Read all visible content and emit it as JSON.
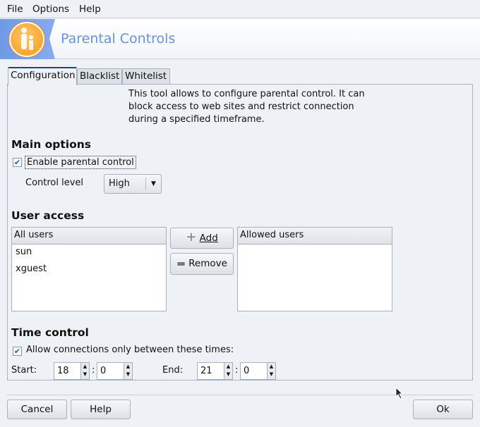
{
  "menu": {
    "file": "File",
    "options": "Options",
    "help": "Help"
  },
  "header": {
    "title": "Parental Controls"
  },
  "tabs": [
    {
      "label": "Configuration"
    },
    {
      "label": "Blacklist"
    },
    {
      "label": "Whitelist"
    }
  ],
  "description": "This tool allows to configure parental control. It can block access to web sites and restrict connection during a specified timeframe.",
  "main_options": {
    "heading": "Main options",
    "enable_label": "Enable parental control",
    "enable_checked": true,
    "level_label": "Control level",
    "level_value": "High"
  },
  "user_access": {
    "heading": "User access",
    "all_header": "All users",
    "all_users": [
      "sun",
      "xguest"
    ],
    "allowed_header": "Allowed users",
    "allowed_users": [],
    "add_label": "Add",
    "remove_label": "Remove"
  },
  "time_control": {
    "heading": "Time control",
    "allow_label": "Allow connections only between these times:",
    "allow_checked": true,
    "start_label": "Start:",
    "start_hour": "18",
    "start_min": "0",
    "end_label": "End:",
    "end_hour": "21",
    "end_min": "0",
    "colon": ":"
  },
  "buttons": {
    "cancel": "Cancel",
    "help": "Help",
    "ok": "Ok"
  }
}
